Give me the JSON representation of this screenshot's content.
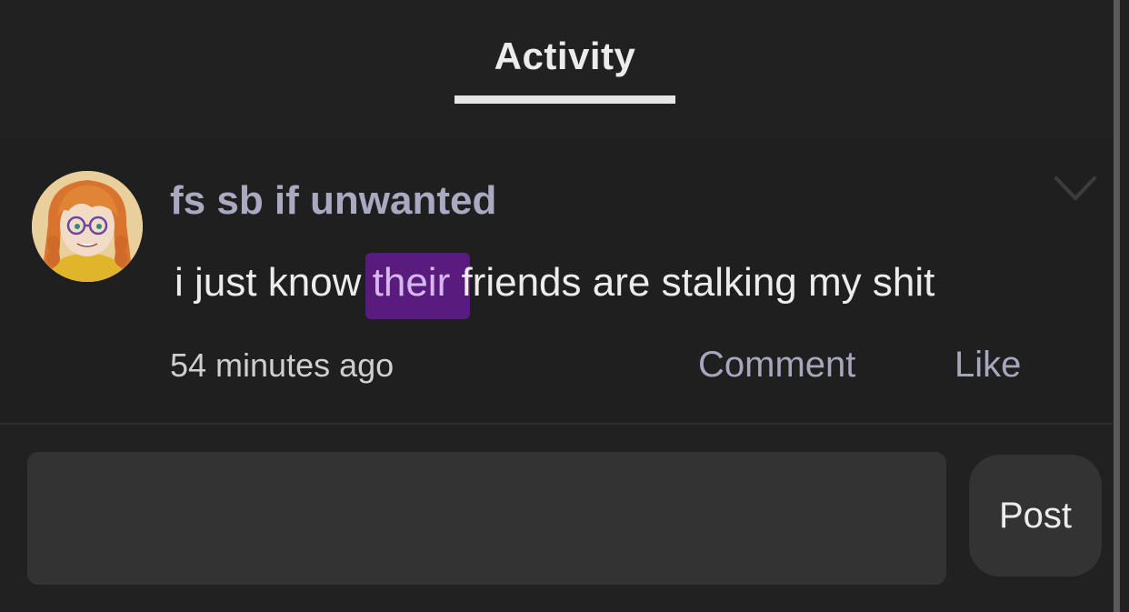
{
  "header": {
    "active_tab": "Activity"
  },
  "post": {
    "author": "fs sb if unwanted",
    "message_before": "i just know ",
    "message_highlight": "their",
    "message_after": " friends are stalking my shit",
    "timestamp": "54 minutes ago",
    "comment_label": "Comment",
    "like_label": "Like",
    "menu_icon": "chevron-down-icon",
    "highlight_color": "#701ca4"
  },
  "reply": {
    "value": "",
    "placeholder": "",
    "post_label": "Post"
  },
  "colors": {
    "background": "#212121",
    "author": "#a9a9c2",
    "action": "#a6a6bd",
    "input_bg": "#333333"
  }
}
